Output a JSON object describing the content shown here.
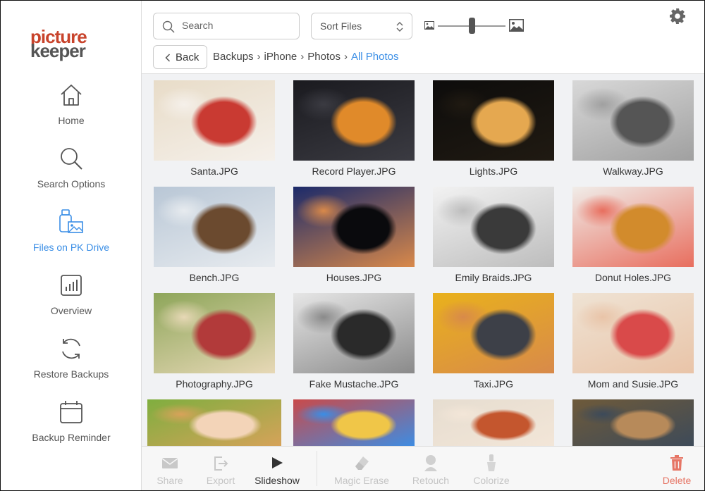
{
  "brand": {
    "line1": "picture",
    "line2": "keeper"
  },
  "sidebar": {
    "items": [
      {
        "label": "Home",
        "icon": "home-icon",
        "active": false
      },
      {
        "label": "Search Options",
        "icon": "search-icon",
        "active": false
      },
      {
        "label": "Files on PK Drive",
        "icon": "pk-drive-icon",
        "active": true
      },
      {
        "label": "Overview",
        "icon": "chart-icon",
        "active": false
      },
      {
        "label": "Restore Backups",
        "icon": "restore-icon",
        "active": false
      },
      {
        "label": "Backup Reminder",
        "icon": "calendar-icon",
        "active": false
      }
    ]
  },
  "toolbar_top": {
    "search_placeholder": "Search",
    "sort_label": "Sort Files",
    "back_label": "Back",
    "zoom_level": 0.5
  },
  "breadcrumb": [
    "Backups",
    "iPhone",
    "Photos",
    "All Photos"
  ],
  "photos": [
    {
      "name": "Santa.JPG",
      "colors": [
        "#e8dcc8",
        "#c93a32",
        "#f5f0ea"
      ]
    },
    {
      "name": "Record Player.JPG",
      "colors": [
        "#1a1a1f",
        "#e08a2a",
        "#3b3b42"
      ]
    },
    {
      "name": "Lights.JPG",
      "colors": [
        "#0d0c0b",
        "#e5a850",
        "#201a12"
      ]
    },
    {
      "name": "Walkway.JPG",
      "colors": [
        "#d8d8d8",
        "#555555",
        "#a0a0a0"
      ]
    },
    {
      "name": "Bench.JPG",
      "colors": [
        "#b9c7d6",
        "#6b4a2f",
        "#e7ebef"
      ]
    },
    {
      "name": "Houses.JPG",
      "colors": [
        "#1b2a6a",
        "#0a0a0d",
        "#d9894a"
      ]
    },
    {
      "name": "Emily Braids.JPG",
      "colors": [
        "#f2f2f2",
        "#3a3a3a",
        "#bdbdbd"
      ]
    },
    {
      "name": "Donut Holes.JPG",
      "colors": [
        "#f0ede9",
        "#d28b2c",
        "#e86e5e"
      ]
    },
    {
      "name": "Photography.JPG",
      "colors": [
        "#8ea65a",
        "#b23a3a",
        "#e7d8b6"
      ]
    },
    {
      "name": "Fake Mustache.JPG",
      "colors": [
        "#e6e6e6",
        "#2a2a2a",
        "#8a8a8a"
      ]
    },
    {
      "name": "Taxi.JPG",
      "colors": [
        "#e9b11c",
        "#3d4048",
        "#d88a4a"
      ]
    },
    {
      "name": "Mom and Susie.JPG",
      "colors": [
        "#efe3d4",
        "#d94a4a",
        "#e9c4a8"
      ]
    },
    {
      "name": "",
      "colors": [
        "#7fae3f",
        "#f3d4b8",
        "#d8a25a"
      ]
    },
    {
      "name": "",
      "colors": [
        "#c94a4a",
        "#f0c648",
        "#3a8ee6"
      ]
    },
    {
      "name": "",
      "colors": [
        "#e6ddd0",
        "#c4562e",
        "#f3e6d8"
      ]
    },
    {
      "name": "",
      "colors": [
        "#6e5a3a",
        "#b78a5a",
        "#3c4a5a"
      ]
    }
  ],
  "bottom_toolbar": [
    {
      "label": "Share",
      "icon": "envelope-icon",
      "enabled": false
    },
    {
      "label": "Export",
      "icon": "export-icon",
      "enabled": false
    },
    {
      "label": "Slideshow",
      "icon": "play-icon",
      "enabled": true
    },
    {
      "label": "Magic Erase",
      "icon": "eraser-icon",
      "enabled": false
    },
    {
      "label": "Retouch",
      "icon": "retouch-icon",
      "enabled": false
    },
    {
      "label": "Colorize",
      "icon": "colorize-icon",
      "enabled": false
    },
    {
      "label": "Delete",
      "icon": "trash-icon",
      "enabled": true
    }
  ]
}
